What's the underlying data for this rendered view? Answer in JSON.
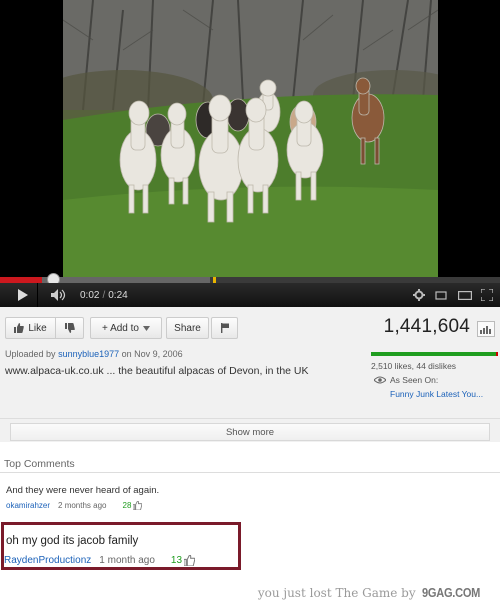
{
  "player": {
    "current_time": "0:02",
    "duration": "0:24",
    "time_separator": "/",
    "progress_fraction": 0.083
  },
  "actions": {
    "like_label": "Like",
    "addto_label": "+ Add to",
    "share_label": "Share",
    "views": "1,441,604"
  },
  "info": {
    "uploaded_prefix": "Uploaded by",
    "uploader": "sunnyblue1977",
    "uploaded_date": "on Nov 9, 2006",
    "description": "www.alpaca-uk.co.uk ... the beautiful alpacas of Devon, in the UK",
    "likes_dislikes": "2,510 likes, 44 dislikes",
    "like_fraction": 0.983,
    "seen_on_label": "As Seen On:",
    "seen_on_links": "Funny Junk Latest You..."
  },
  "show_more_label": "Show more",
  "comments": {
    "heading": "Top Comments",
    "items": [
      {
        "text": "And they were never heard of again.",
        "author": "okamirahzer",
        "age": "2 months ago",
        "likes": "28"
      },
      {
        "text": "oh my god its jacob family",
        "author": "RaydenProductionz",
        "age": "1 month ago",
        "likes": "13"
      }
    ]
  },
  "footer": {
    "text": "you just lost The Game by",
    "brand": "9GAG.COM"
  },
  "colors": {
    "accent_red": "#cc181e",
    "link_blue": "#1c62b9",
    "like_green": "#1f9d1f",
    "highlight_border": "#7a1a2a"
  }
}
